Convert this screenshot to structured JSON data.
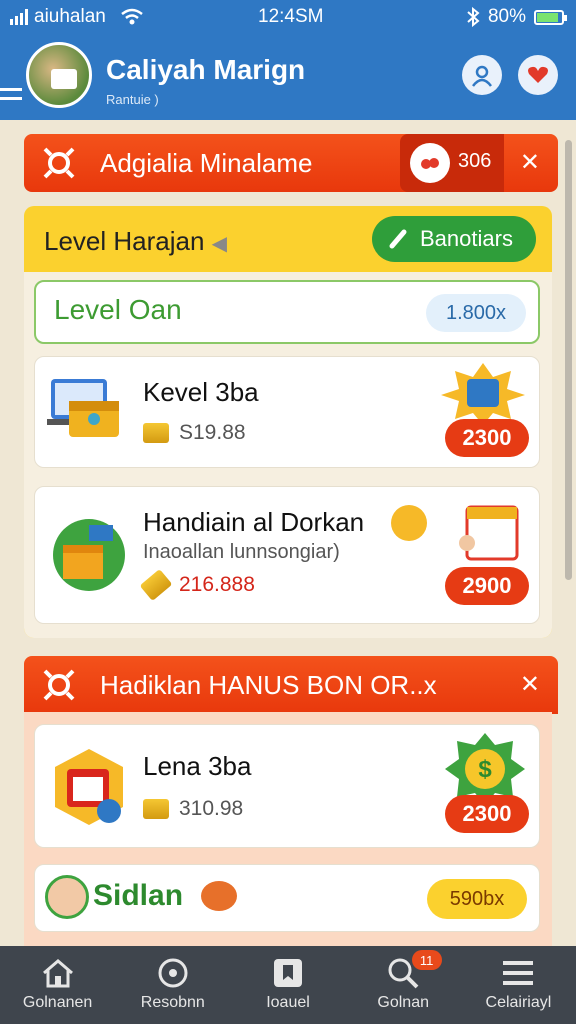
{
  "status_bar": {
    "carrier": "aiuhalan",
    "time": "12:4SM",
    "battery": "80%",
    "battery_level": 0.8
  },
  "header": {
    "title": "Caliyah Marign",
    "subtitle": "Rantuie )"
  },
  "promo_banner": {
    "label": "Adgialia Minalame",
    "count": "306"
  },
  "level_panel": {
    "title": "Level Harajan",
    "bonus_button": "Banotiars",
    "level_card": {
      "label": "Level Oan",
      "value": "1.800x"
    },
    "items": [
      {
        "title": "Kevel 3ba",
        "price": "S19.88",
        "badge": "2300"
      },
      {
        "title": "Handiain al Dorkan",
        "subtitle": "Inaoallan lunnsongiar)",
        "price": "216.888",
        "badge": "2900"
      }
    ]
  },
  "bonus_banner": {
    "label": "Hadiklan HANUS BON OR..x"
  },
  "bonus_panel": {
    "items": [
      {
        "title": "Lena 3ba",
        "price": "310.98",
        "badge": "2300"
      }
    ],
    "user_card": {
      "name": "Sidlan",
      "value": "590bx"
    }
  },
  "bottom_nav": [
    {
      "label": "Golnanen",
      "icon": "home-icon"
    },
    {
      "label": "Resobnn",
      "icon": "target-icon"
    },
    {
      "label": "Ioauel",
      "icon": "bookmark-icon"
    },
    {
      "label": "Golnan",
      "icon": "search-icon",
      "badge": "11"
    },
    {
      "label": "Celairiayl",
      "icon": "menu-icon"
    }
  ],
  "colors": {
    "primary_blue": "#2f78c4",
    "accent_orange": "#e8380c",
    "panel_yellow": "#fbd12e",
    "green": "#2f9e3a",
    "price_red": "#d4261a"
  }
}
